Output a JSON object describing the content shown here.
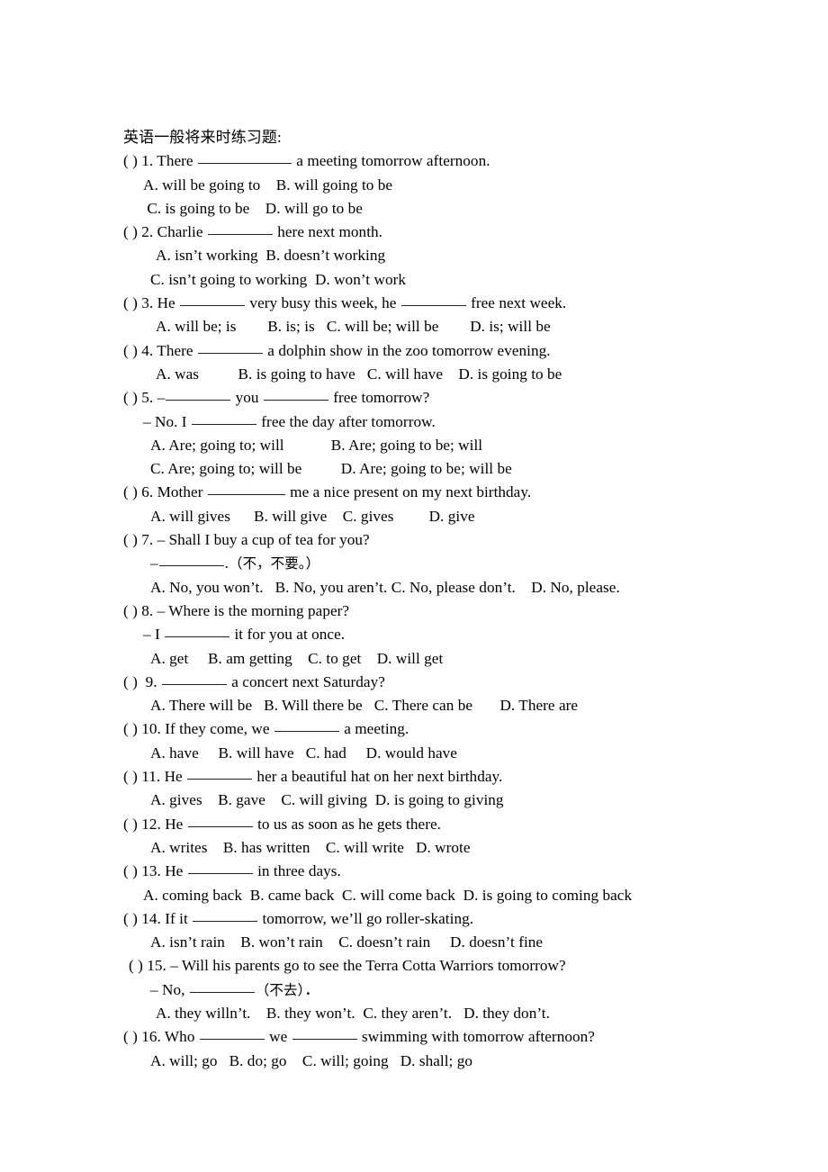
{
  "document": {
    "title": "英语一般将来时练习题:",
    "blank_marker": "( )"
  },
  "questions": [
    {
      "number": "1",
      "stem_prefix": "( ) 1. There ",
      "stem_suffix": " a meeting tomorrow afternoon.",
      "option_lines": [
        "A. will be going to    B. will going to be",
        " C. is going to be    D. will go to be"
      ]
    },
    {
      "number": "2",
      "stem_prefix": "( ) 2. Charlie ",
      "stem_suffix": " here next month.",
      "option_lines": [
        "A. isn’t working  B. doesn’t working",
        "C. isn’t going to working  D. won’t work"
      ]
    },
    {
      "number": "3",
      "stem_prefix": "( ) 3. He ",
      "stem_mid": " very busy this week, he ",
      "stem_suffix": " free next week.",
      "option_lines": [
        "A. will be; is        B. is; is   C. will be; will be        D. is; will be"
      ]
    },
    {
      "number": "4",
      "stem_prefix": "( ) 4. There ",
      "stem_suffix": " a dolphin show in the zoo tomorrow evening.",
      "option_lines": [
        "A. was          B. is going to have   C. will have    D. is going to be"
      ]
    },
    {
      "number": "5",
      "stem_prefix": "( ) 5. –",
      "stem_mid": " you ",
      "stem_suffix": " free tomorrow?",
      "reply_prefix": "– No. I ",
      "reply_suffix": " free the day after tomorrow.",
      "option_lines": [
        "A. Are; going to; will            B. Are; going to be; will",
        "C. Are; going to; will be          D. Are; going to be; will be"
      ]
    },
    {
      "number": "6",
      "stem_prefix": "( ) 6. Mother ",
      "stem_suffix": " me a nice present on my next birthday.",
      "option_lines": [
        "A. will gives      B. will give    C. gives         D. give"
      ]
    },
    {
      "number": "7",
      "stem_line": "( ) 7. – Shall I buy a cup of tea for you?",
      "reply_prefix": "–",
      "reply_suffix": ".",
      "reply_cn": "（不，不要。）",
      "option_lines": [
        "A. No, you won’t.   B. No, you aren’t. C. No, please don’t.    D. No, please."
      ]
    },
    {
      "number": "8",
      "stem_line": "( ) 8. – Where is the morning paper?",
      "reply_prefix": "– I ",
      "reply_suffix": " it for you at once.",
      "option_lines": [
        "A. get     B. am getting    C. to get    D. will get"
      ]
    },
    {
      "number": "9",
      "stem_prefix": "( )  9. ",
      "stem_suffix": " a concert next Saturday?",
      "option_lines": [
        "A. There will be   B. Will there be   C. There can be       D. There are"
      ]
    },
    {
      "number": "10",
      "stem_prefix": "( ) 10. If they come, we ",
      "stem_suffix": " a meeting.",
      "option_lines": [
        "A. have     B. will have   C. had     D. would have"
      ]
    },
    {
      "number": "11",
      "stem_prefix": "( ) 11. He ",
      "stem_suffix": " her a beautiful hat on her next birthday.",
      "option_lines": [
        "A. gives    B. gave    C. will giving  D. is going to giving"
      ]
    },
    {
      "number": "12",
      "stem_prefix": "( ) 12. He ",
      "stem_suffix": " to us as soon as he gets there.",
      "option_lines": [
        "A. writes    B. has written    C. will write   D. wrote"
      ]
    },
    {
      "number": "13",
      "stem_prefix": "( ) 13. He ",
      "stem_suffix": " in three days.",
      "option_lines": [
        "A. coming back  B. came back  C. will come back  D. is going to coming back"
      ]
    },
    {
      "number": "14",
      "stem_prefix": "( ) 14. If it ",
      "stem_suffix": " tomorrow, we’ll go roller-skating.",
      "option_lines": [
        "A. isn’t rain    B. won’t rain    C. doesn’t rain     D. doesn’t fine"
      ]
    },
    {
      "number": "15",
      "stem_line": "( ) 15. – Will his parents go to see the Terra Cotta Warriors tomorrow?",
      "reply_prefix": "– No, ",
      "reply_cn": "（不去）",
      "reply_suffix": "．",
      "option_lines": [
        "A. they willn’t.    B. they won’t.  C. they aren’t.   D. they don’t."
      ]
    },
    {
      "number": "16",
      "stem_prefix": "( ) 16. Who ",
      "stem_mid": " we ",
      "stem_suffix": " swimming with tomorrow afternoon?",
      "option_lines": [
        "A. will; go   B. do; go    C. will; going   D. shall; go"
      ]
    }
  ]
}
